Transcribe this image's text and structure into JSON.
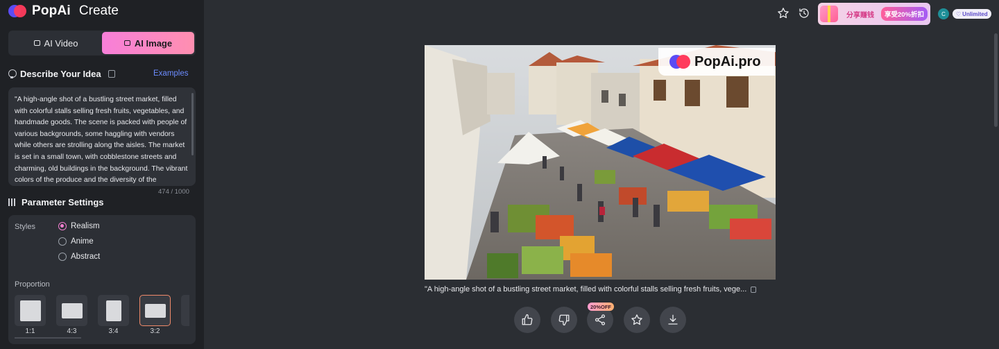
{
  "brand": {
    "name": "PopAi",
    "section": "Create"
  },
  "mode_tabs": [
    {
      "label": "AI Video",
      "active": false
    },
    {
      "label": "AI Image",
      "active": true
    }
  ],
  "describe": {
    "title": "Describe Your Idea",
    "examples_link": "Examples",
    "prompt": "\"A high-angle shot of a bustling street market, filled with colorful stalls selling fresh fruits, vegetables, and handmade goods. The scene is packed with people of various backgrounds, some haggling with vendors while others are strolling along the aisles. The market is set in a small town, with cobblestone streets and charming, old buildings in the background. The vibrant colors of the produce and the diversity of the",
    "char_count": "474 / 1000"
  },
  "params": {
    "title": "Parameter Settings",
    "styles_label": "Styles",
    "styles": [
      {
        "label": "Realism",
        "selected": true
      },
      {
        "label": "Anime",
        "selected": false
      },
      {
        "label": "Abstract",
        "selected": false
      }
    ],
    "proportion_label": "Proportion",
    "proportions": [
      {
        "label": "1:1",
        "selected": false
      },
      {
        "label": "4:3",
        "selected": false
      },
      {
        "label": "3:4",
        "selected": false
      },
      {
        "label": "3:2",
        "selected": true
      }
    ]
  },
  "topbar": {
    "promo_text": "分享赚钱",
    "promo_badge": "享受20%折扣",
    "avatar_initial": "C",
    "plan": "Unlimited"
  },
  "result": {
    "watermark": "PopAi.pro",
    "caption": "\"A high-angle shot of a bustling street market, filled with colorful stalls selling fresh fruits, vege...",
    "share_badge": "20%OFF"
  },
  "colors": {
    "accent_pink": "#f27fd0",
    "link_blue": "#6c8cff",
    "sidebar_bg": "#1f2125",
    "main_bg": "#2b2e33"
  },
  "icons": [
    "bulb-icon",
    "copy-icon",
    "sliders-icon",
    "star-icon",
    "history-icon",
    "gift-icon",
    "thumbs-up-icon",
    "thumbs-down-icon",
    "share-icon",
    "download-icon"
  ]
}
